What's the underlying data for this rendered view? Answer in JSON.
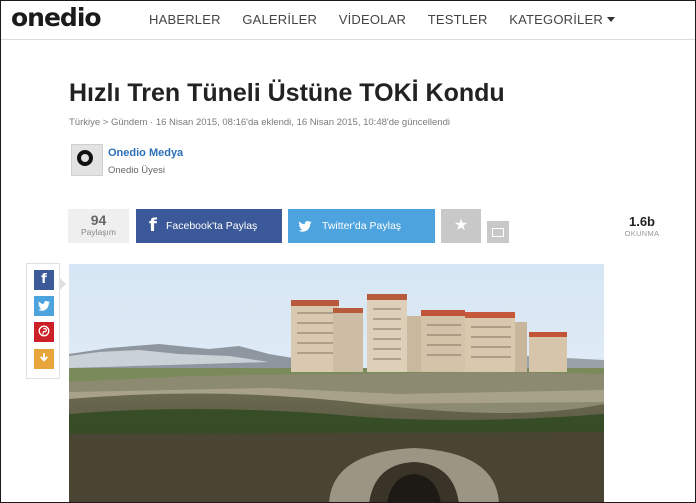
{
  "header": {
    "logo": "onedio",
    "nav": [
      "HABERLER",
      "GALERİLER",
      "VİDEOLAR",
      "TESTLER",
      "KATEGORİLER"
    ]
  },
  "article": {
    "title": "Hızlı Tren Tüneli Üstüne TOKİ Kondu",
    "meta": "Türkiye > Gündem  ·  16 Nisan 2015, 08:16'da eklendi, 16 Nisan 2015, 10:48'de güncellendi",
    "author_name": "Onedio Medya",
    "author_role": "Onedio Üyesi"
  },
  "share": {
    "count": "94",
    "count_label": "Paylaşım",
    "facebook_label": "Facebook'ta Paylaş",
    "twitter_label": "Twitter'da Paylaş",
    "reads": "1.6b",
    "reads_label": "OKUNMA"
  },
  "icons": [
    "facebook-icon",
    "twitter-icon",
    "pinterest-icon",
    "download-icon",
    "star-icon",
    "mail-icon",
    "caret-down-icon"
  ],
  "colors": {
    "facebook": "#3b5998",
    "twitter": "#4da3dd",
    "pinterest": "#cb2027",
    "download": "#e8a53b",
    "author_link": "#2c6fb7"
  }
}
